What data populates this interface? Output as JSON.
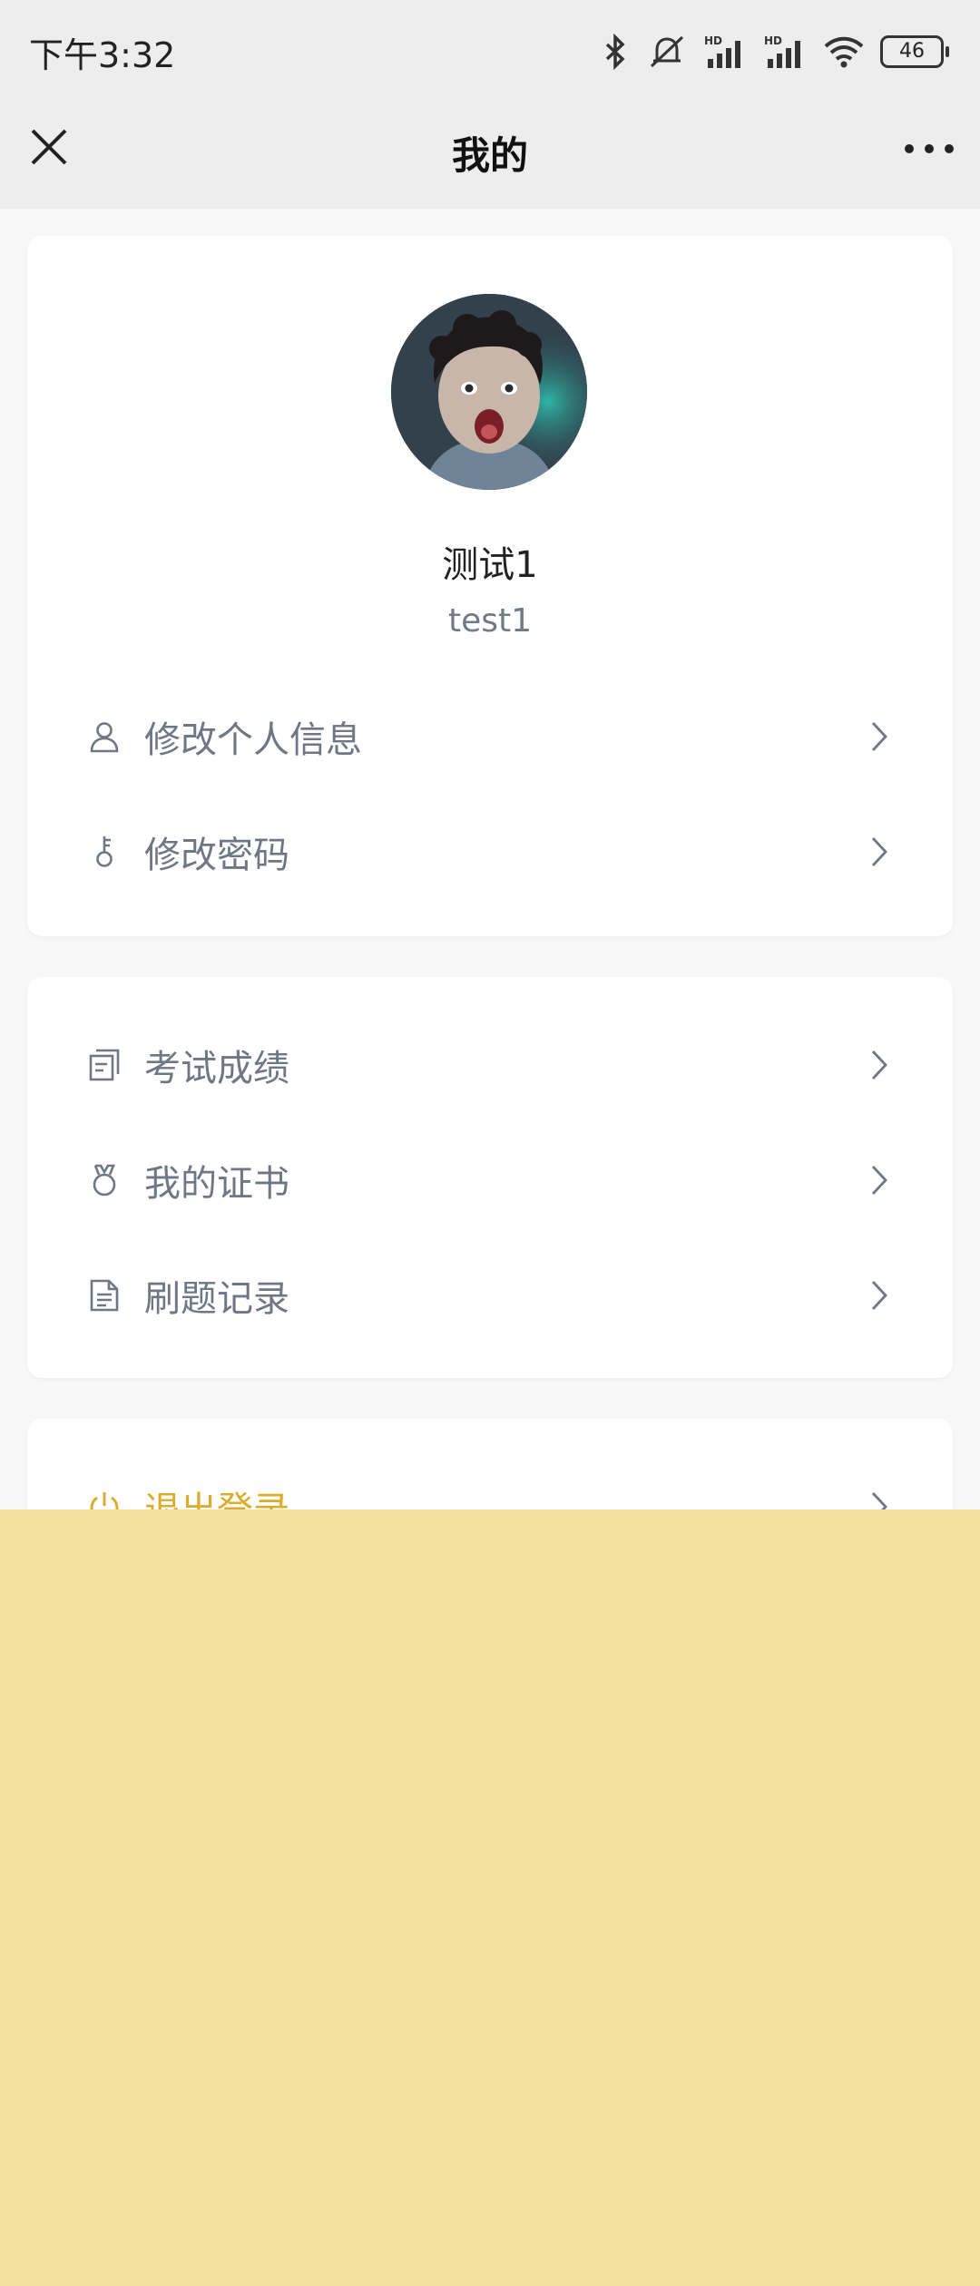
{
  "status_bar": {
    "time": "下午3:32",
    "battery": "46",
    "icons": [
      "bluetooth-icon",
      "mute-icon",
      "signal-hd-icon",
      "signal-hd-icon",
      "wifi-icon",
      "battery-icon"
    ]
  },
  "nav": {
    "title": "我的",
    "close_icon": "close-icon",
    "more_icon": "more-icon"
  },
  "profile": {
    "name": "测试1",
    "account": "test1"
  },
  "menu_profile": [
    {
      "label": "修改个人信息",
      "icon": "user-icon"
    },
    {
      "label": "修改密码",
      "icon": "key-icon"
    }
  ],
  "menu_records": [
    {
      "label": "考试成绩",
      "icon": "score-icon"
    },
    {
      "label": "我的证书",
      "icon": "certificate-icon"
    },
    {
      "label": "刷题记录",
      "icon": "document-icon"
    }
  ],
  "logout": {
    "label": "退出登录",
    "icon": "power-icon"
  },
  "colors": {
    "accent": "#dcad2c",
    "overlay": "#f1e09f",
    "menu_text": "#6e7785",
    "header_bg": "#ededed"
  }
}
